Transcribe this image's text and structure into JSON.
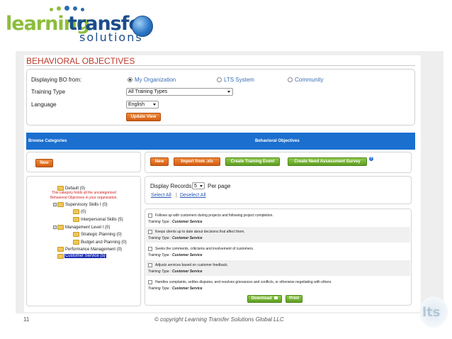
{
  "logo": {
    "word1": "learning",
    "word2": "transfer",
    "word3": "solutions"
  },
  "section_title": "BEHAVIORAL OBJECTIVES",
  "form": {
    "displaying_label": "Displaying BO from:",
    "radios": [
      {
        "label": "My Organization",
        "checked": true
      },
      {
        "label": "LTS System",
        "checked": false
      },
      {
        "label": "Community",
        "checked": false
      }
    ],
    "training_type_label": "Training Type",
    "training_type_value": "All Training Types",
    "language_label": "Language",
    "language_value": "English",
    "update_button": "Update View"
  },
  "bar": {
    "left": "Browse Categories",
    "center": "Behavioral Objectives"
  },
  "left_panel": {
    "new_button": "New",
    "tree": {
      "default": "Default (0)",
      "default_note_1": "This category holds all the uncategorized",
      "default_note_2": "Behavioral Objectives in your organization.",
      "supervisory": "Supervisory Skills I (0)",
      "sup_child": "(0)",
      "interpersonal": "Interpersonal Skills (5)",
      "management": "Management Level I (0)",
      "strategic": "Strategic Planning (0)",
      "budget": "Budget and Planning (0)",
      "performance": "Performance Management (0)",
      "customer": "Customer Service (5)"
    }
  },
  "right_panel": {
    "buttons": {
      "new": "New",
      "import": "Import from .xls",
      "create_event": "Create Training Event",
      "create_survey": "Create Need Assessment Survey"
    },
    "help_icon": "?",
    "display_records_label": "Display Records:",
    "display_records_value": "5",
    "per_page": "Per page",
    "select_all": "Select All",
    "separator": "|",
    "deselect_all": "Deselect All",
    "records": [
      {
        "text": "Follows up with customers during projects and following project completion.",
        "type_label": "Training Type :",
        "type_value": "Customer Service"
      },
      {
        "text": "Keeps clients up to date about decisions that affect them.",
        "type_label": "Training Type :",
        "type_value": "Customer Service"
      },
      {
        "text": "Seeks the comments, criticisms and involvement of customers.",
        "type_label": "Training Type :",
        "type_value": "Customer Service"
      },
      {
        "text": "Adjusts services based on customer feedback.",
        "type_label": "Training Type :",
        "type_value": "Customer Service"
      },
      {
        "text": "Handles complaints, settles disputes, and resolves grievances and conflicts, or otherwise negotiating with others.",
        "type_label": "Training Type :",
        "type_value": "Customer Service"
      }
    ],
    "download_button": "Download",
    "print_button": "Print"
  },
  "footer": {
    "slide_number": "11",
    "copyright": "© copyright Learning Transfer Solutions Global LLC",
    "corner_logo": "lts"
  },
  "colors": {
    "accent_blue": "#1a6fcf",
    "orange": "#e06d20",
    "green": "#6aac2a",
    "title_red": "#c0392b"
  },
  "icons": [
    "globe-icon",
    "folder-icon",
    "help-icon",
    "download-icon",
    "chevron-down-icon"
  ]
}
